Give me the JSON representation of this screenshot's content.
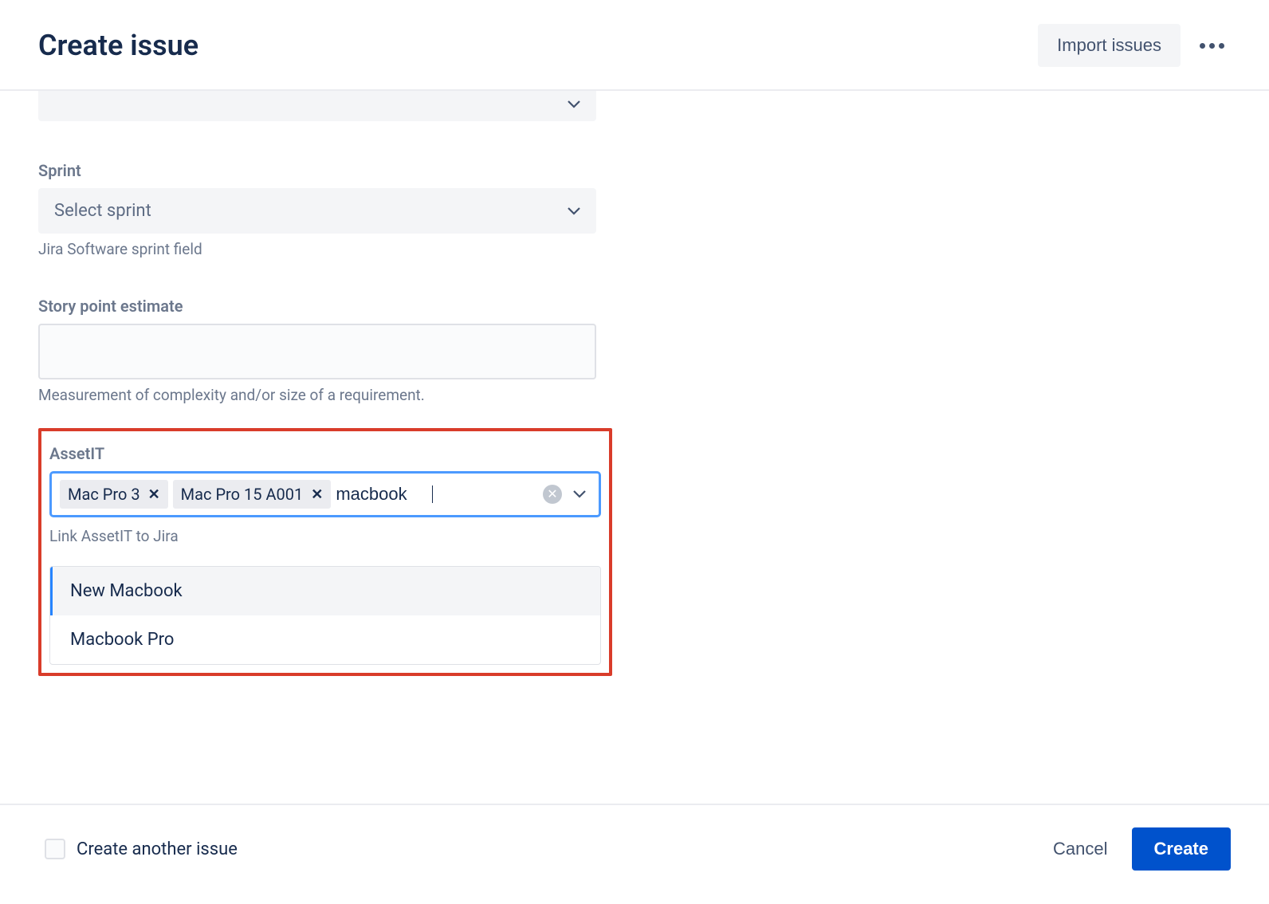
{
  "header": {
    "title": "Create issue",
    "import_label": "Import issues"
  },
  "fields": {
    "sprint": {
      "label": "Sprint",
      "placeholder": "Select sprint",
      "help": "Jira Software sprint field"
    },
    "story_points": {
      "label": "Story point estimate",
      "value": "",
      "help": "Measurement of complexity and/or size of a requirement."
    },
    "assetit": {
      "label": "AssetIT",
      "chips": [
        {
          "label": "Mac Pro 3"
        },
        {
          "label": "Mac Pro 15 A001"
        }
      ],
      "input_value": "macbook",
      "help": "Link AssetIT to Jira",
      "options": [
        "New Macbook",
        "Macbook Pro"
      ]
    }
  },
  "footer": {
    "create_another_label": "Create another issue",
    "cancel_label": "Cancel",
    "create_label": "Create"
  }
}
